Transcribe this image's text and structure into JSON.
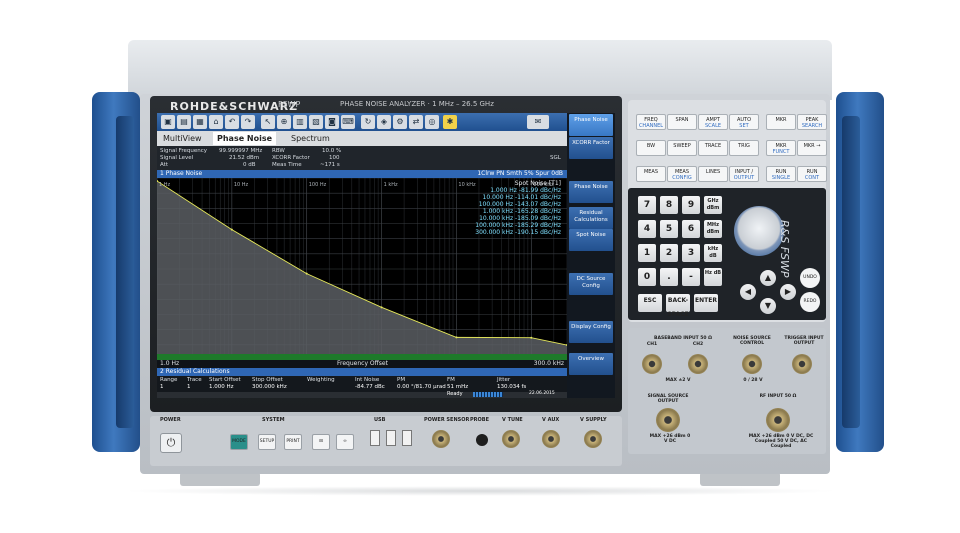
{
  "instrument": {
    "brand": "ROHDE&SCHWARZ",
    "model": "FSWP",
    "analyzer_title": "PHASE NOISE ANALYZER · 1 MHz – 26.5 GHz",
    "side_label": "R&S FSWP"
  },
  "screen": {
    "tabs": {
      "multiview": "MultiView",
      "phase_noise": "Phase Noise",
      "spectrum": "Spectrum"
    },
    "info": {
      "signal_frequency_label": "Signal Frequency",
      "signal_frequency_value": "99.999997 MHz",
      "signal_level_label": "Signal Level",
      "signal_level_value": "21.52 dBm",
      "att_label": "Att",
      "att_value": "0 dB",
      "rbw_label": "RBW",
      "rbw_value": "10.0 %",
      "xcorr_label": "XCORR Factor",
      "xcorr_value": "100",
      "meas_time_label": "Meas Time",
      "meas_time_value": "~171 s",
      "sgl": "SGL"
    },
    "window_title": "1 Phase Noise",
    "trace_legend": "1Clrw PN Smth 5% Spur 0dB",
    "spot_noise": {
      "header": "Spot Noise [T1]",
      "rows": [
        {
          "offset": "1.000 Hz",
          "value": "-81.99 dBc/Hz"
        },
        {
          "offset": "10.000 Hz",
          "value": "-114.01 dBc/Hz"
        },
        {
          "offset": "100.000 Hz",
          "value": "-143.07 dBc/Hz"
        },
        {
          "offset": "1.000 kHz",
          "value": "-165.28 dBc/Hz"
        },
        {
          "offset": "10.000 kHz",
          "value": "-185.09 dBc/Hz"
        },
        {
          "offset": "100.000 kHz",
          "value": "-185.29 dBc/Hz"
        },
        {
          "offset": "300.000 kHz",
          "value": "-190.15 dBc/Hz"
        }
      ]
    },
    "x_start": "1.0 Hz",
    "x_label": "Frequency Offset",
    "x_stop": "300.0 kHz",
    "residual": {
      "title": "2 Residual Calculations",
      "headers": [
        "Range",
        "Trace",
        "Start Offset",
        "Stop Offset",
        "Weighting",
        "Int Noise",
        "PM",
        "FM",
        "Jitter"
      ],
      "row": [
        "1",
        "1",
        "1.000 Hz",
        "300.000 kHz",
        "",
        "-84.77 dBc",
        "0.00 °/81.70 µrad",
        "51 mHz",
        "130.034 fs"
      ]
    },
    "status": {
      "ready": "Ready",
      "date": "22.06.2015",
      "time": "13:38:03"
    },
    "softkeys": [
      "Phase Noise",
      "XCORR Factor",
      "Phase Noise",
      "Residual Calculations",
      "Spot Noise",
      "DC Source Config",
      "Display Config",
      "Overview"
    ]
  },
  "function_keys": [
    {
      "line1": "FREQ",
      "line2": "CHANNEL"
    },
    {
      "line1": "SPAN",
      "line2": ""
    },
    {
      "line1": "AMPT",
      "line2": "SCALE"
    },
    {
      "line1": "AUTO",
      "line2": "SET"
    },
    {
      "line1": "MKR",
      "line2": ""
    },
    {
      "line1": "PEAK",
      "line2": "SEARCH"
    },
    {
      "line1": "BW",
      "line2": ""
    },
    {
      "line1": "SWEEP",
      "line2": ""
    },
    {
      "line1": "TRACE",
      "line2": ""
    },
    {
      "line1": "TRIG",
      "line2": ""
    },
    {
      "line1": "MKR",
      "line2": "FUNCT"
    },
    {
      "line1": "MKR →",
      "line2": ""
    },
    {
      "line1": "MEAS",
      "line2": ""
    },
    {
      "line1": "MEAS",
      "line2": "CONFIG"
    },
    {
      "line1": "LINES",
      "line2": ""
    },
    {
      "line1": "INPUT /",
      "line2": "OUTPUT"
    },
    {
      "line1": "RUN",
      "line2": "SINGLE"
    },
    {
      "line1": "RUN",
      "line2": "CONT"
    }
  ],
  "numpad": {
    "digits": [
      "7",
      "8",
      "9",
      "4",
      "5",
      "6",
      "1",
      "2",
      "3",
      "0",
      ".",
      "-"
    ],
    "units": [
      "GHz dBm",
      "MHz dBm",
      "kHz dB",
      "Hz dB"
    ],
    "esc": "ESC",
    "backspace": "BACK-SPACE",
    "enter": "ENTER",
    "undo": "UNDO",
    "redo": "REDO"
  },
  "connectors": {
    "baseband": "BASEBAND INPUT 50 Ω",
    "ch1": "CH1",
    "ch2": "CH2",
    "baseband_max": "MAX ±2 V",
    "noise_source": "NOISE SOURCE CONTROL",
    "noise_max": "0 / 28 V",
    "trigger": "TRIGGER INPUT OUTPUT",
    "signal_source": "SIGNAL SOURCE OUTPUT",
    "signal_max": "MAX +26 dBm 0 V DC",
    "rf_input": "RF INPUT 50 Ω",
    "rf_max": "MAX +26 dBm 0 V DC, DC Coupled 50 V DC, AC Coupled"
  },
  "bottom": {
    "power": "POWER",
    "system": "SYSTEM",
    "usb": "USB",
    "power_sensor": "POWER SENSOR",
    "probe": "PROBE",
    "v_tune": "V TUNE",
    "v_aux": "V AUX",
    "v_supply": "V SUPPLY",
    "keys": [
      "MODE",
      "SETUP",
      "PRINT",
      "⊟",
      "∞"
    ]
  },
  "chart_data": {
    "type": "line",
    "x_scale": "log",
    "x_ticks": [
      "1 Hz",
      "10 Hz",
      "100 Hz",
      "1 kHz",
      "10 kHz",
      "100 kHz"
    ],
    "y_range": [
      -200,
      -80
    ],
    "series": [
      {
        "x": [
          1,
          10,
          100,
          1000,
          10000,
          100000,
          300000
        ],
        "values": [
          -81.99,
          -114.01,
          -143.07,
          -165.28,
          -185.09,
          -185.29,
          -190.15
        ]
      }
    ]
  }
}
